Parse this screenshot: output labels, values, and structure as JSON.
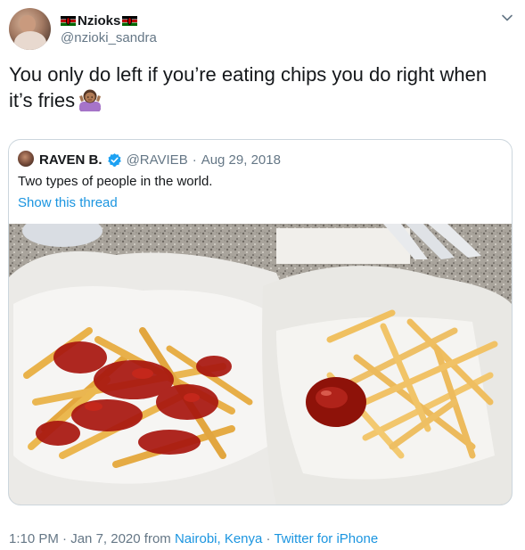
{
  "author": {
    "display_name": "Nzioks",
    "handle": "@nzioki_sandra"
  },
  "tweet": {
    "text": "You only do left if you’re eating chips you do right when it’s fries"
  },
  "quoted_tweet": {
    "display_name": "RAVEN B.",
    "handle": "@RAVIEB",
    "separator": "·",
    "date": "Aug 29, 2018",
    "text": "Two types of people in the world.",
    "thread_link": "Show this thread"
  },
  "footer": {
    "time": "1:10 PM",
    "sep1": "·",
    "date": "Jan 7, 2020",
    "from_label": "from",
    "location": "Nairobi, Kenya",
    "sep2": "·",
    "source": "Twitter for iPhone"
  },
  "icons": {
    "author_flags": "kenya-flag-icon",
    "verified": "verified-badge-icon",
    "menu": "chevron-down-icon",
    "emoji": "person-shrugging-emoji"
  },
  "colors": {
    "link": "#1b95e0",
    "muted": "#657786",
    "text": "#14171a",
    "border": "#ccd6dd",
    "verified": "#1da1f2"
  }
}
